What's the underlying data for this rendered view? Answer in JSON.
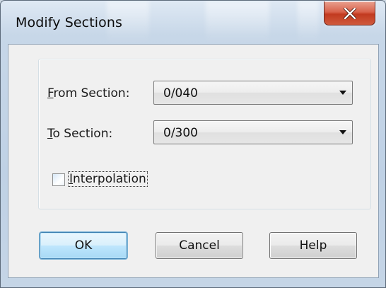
{
  "window": {
    "title": "Modify Sections",
    "close_icon": "close-icon"
  },
  "form": {
    "from_section": {
      "label_accel": "F",
      "label_rest": "rom Section:",
      "value": "0/040"
    },
    "to_section": {
      "label_accel": "T",
      "label_rest": "o Section:",
      "value": "0/300"
    },
    "interpolation": {
      "label_accel": "I",
      "label_rest": "nterpolation",
      "checked": false
    }
  },
  "buttons": {
    "ok": "OK",
    "cancel": "Cancel",
    "help": "Help"
  },
  "colors": {
    "close_button": "#c94a30",
    "default_button_border": "#3c7fb1",
    "dialog_face": "#f0f0f0"
  }
}
